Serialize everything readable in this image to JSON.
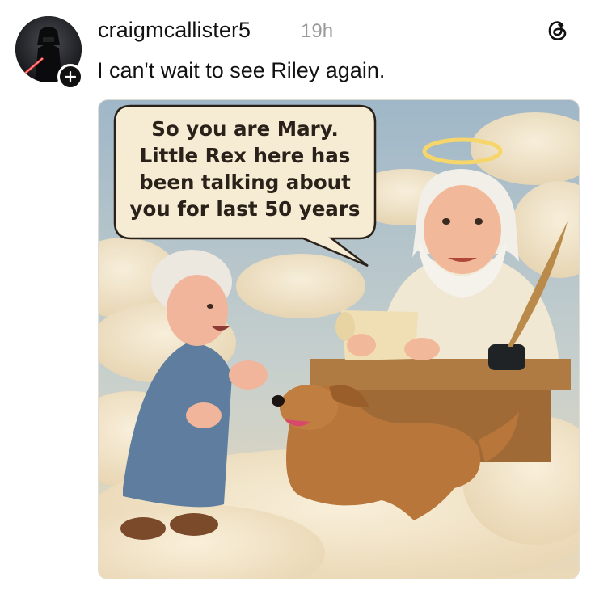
{
  "post": {
    "username": "craigmcallister5",
    "time": "19h",
    "text": "I can't wait to see Riley again."
  },
  "image": {
    "speech_lines": [
      "So you are Mary.",
      "Little Rex here has",
      "been talking about",
      "you for last 50 years"
    ]
  },
  "icons": {
    "follow": "plus-icon",
    "app": "threads-logo-icon"
  },
  "colors": {
    "username": "#111111",
    "time": "#9a9a9a",
    "sky": "#a9c0cf",
    "cloud": "#f3e6c9"
  }
}
